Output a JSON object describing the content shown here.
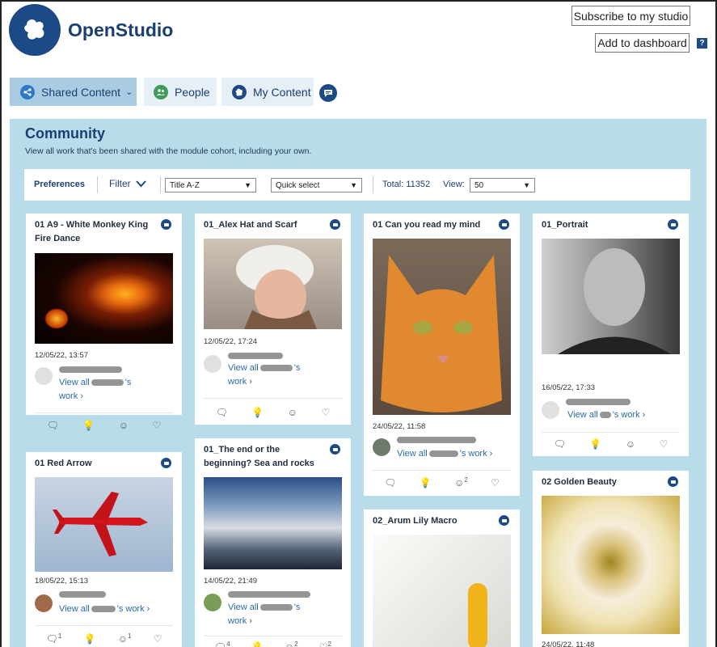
{
  "brand": {
    "name": "OpenStudio"
  },
  "header": {
    "subscribe_label": "Subscribe to my studio",
    "dashboard_label": "Add to dashboard",
    "help_label": "?"
  },
  "nav": {
    "shared_label": "Shared Content",
    "people_label": "People",
    "mycontent_label": "My Content"
  },
  "community": {
    "title": "Community",
    "description": "View all work that's been shared with the module cohort, including your own."
  },
  "prefs": {
    "label": "Preferences",
    "filter_label": "Filter",
    "sort_value": "Title A-Z",
    "quick_select_value": "Quick select",
    "total_text": "Total: 11352",
    "view_label": "View:",
    "view_value": "50"
  },
  "cards": [
    {
      "title": "01 A9 - White Monkey King Fire Dance",
      "date": "12/05/22, 13:57",
      "view_all_prefix": "View all",
      "view_all_suffix": "'s",
      "work_label": "work ›",
      "actions": [
        "",
        "",
        "",
        ""
      ]
    },
    {
      "title": "01 Red Arrow",
      "date": "18/05/22, 15:13",
      "view_all_prefix": "View all",
      "view_all_suffix": "'s work ›",
      "actions": [
        "1",
        "",
        "1",
        ""
      ]
    },
    {
      "title": "01_Alex Hat and Scarf",
      "date": "12/05/22, 17:24",
      "view_all_prefix": "View all",
      "view_all_suffix": "'s",
      "work_label": "work ›",
      "actions": [
        "",
        "",
        "",
        ""
      ]
    },
    {
      "title": "01_The end or the beginning? Sea and rocks",
      "date": "14/05/22, 21:49",
      "view_all_prefix": "View all",
      "view_all_suffix": "'s",
      "work_label": "work ›",
      "actions": [
        "4",
        "",
        "2",
        "2"
      ]
    },
    {
      "title": "01 Can you read my mind",
      "date": "24/05/22, 11:58",
      "view_all_prefix": "View all",
      "view_all_suffix": "'s work ›",
      "actions": [
        "",
        "",
        "2",
        ""
      ]
    },
    {
      "title": "02_Arum Lily Macro"
    },
    {
      "title": "01_Portrait",
      "date": "16/05/22, 17:33",
      "view_all_prefix": "View all",
      "view_all_suffix": "'s work ›",
      "actions": [
        "",
        "",
        "",
        ""
      ]
    },
    {
      "title": "02 Golden Beauty",
      "date": "24/05/22, 11:48"
    }
  ],
  "icons": [
    "logo-icon",
    "share-icon",
    "people-icon",
    "mycontent-icon",
    "chat-icon",
    "comment-icon",
    "inspire-icon",
    "smile-icon",
    "heart-icon"
  ],
  "colors": {
    "brand": "#1b4a86",
    "panel": "#b9dcea",
    "tab_active": "#a9cce3",
    "link": "#2a6aa8"
  }
}
